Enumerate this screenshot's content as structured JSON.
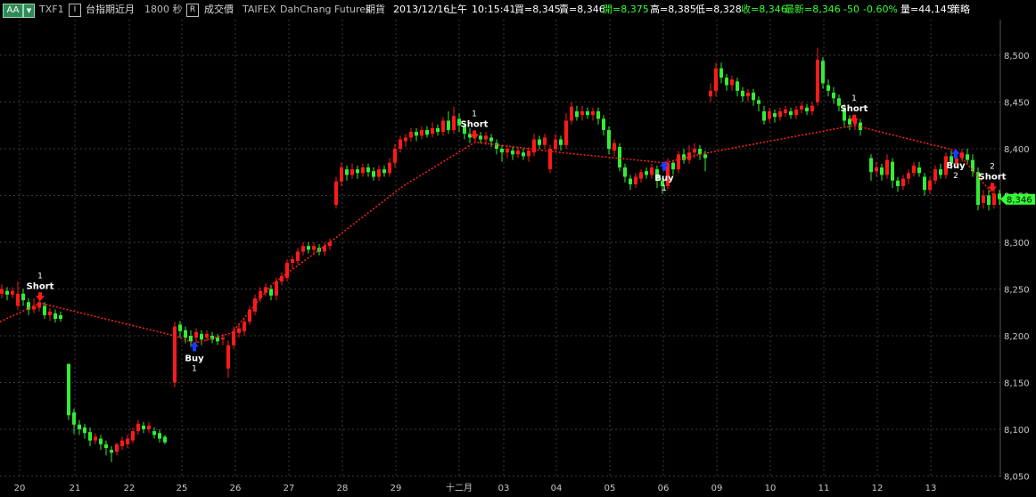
{
  "toolbar": {
    "aa_button": "AA",
    "symbol": "TXF1",
    "i_button": "I",
    "name": "台指期近月",
    "interval": "1800 秒",
    "r_button": "R",
    "price_type": "成交價",
    "exchange": "TAIFEX",
    "broker": "DahChang Futures",
    "category": "期貨",
    "date": "2013/12/16",
    "session": "上午",
    "time": "10:15:41",
    "bid": "買=8,345",
    "ask": "賣=8,346",
    "open": "開=8,375",
    "high": "高=8,385",
    "low": "低=8,328",
    "close": "收=8,346",
    "latest": "最新=8,346",
    "change": "-50",
    "change_pct": "-0.60%",
    "volume": "量=44,145",
    "strategy": "策略",
    "colors": {
      "green": "#33ff33",
      "white": "#ffffff"
    }
  },
  "chart_data": {
    "type": "candlestick",
    "ylim": [
      8040,
      8520
    ],
    "y_ticks": [
      "8,500",
      "8,450",
      "8,400",
      "8,350",
      "8,300",
      "8,250",
      "8,200",
      "8,150",
      "8,100",
      "8,050"
    ],
    "x_ticks": [
      "20",
      "21",
      "22",
      "25",
      "26",
      "27",
      "28",
      "29",
      "十二月",
      "03",
      "04",
      "05",
      "06",
      "09",
      "10",
      "11",
      "12",
      "13"
    ],
    "last_price": "8,346",
    "colors": {
      "up": "#ff1a1a",
      "down": "#33ee33",
      "signal_line": "#ff2020",
      "buy": "#1a3cff",
      "short": "#ff1a1a",
      "grid": "#3a3a3a",
      "last_bg": "#33ff33"
    },
    "signal_path": [
      [
        0,
        8215
      ],
      [
        45,
        8235
      ],
      [
        196,
        8200
      ],
      [
        218,
        8192
      ],
      [
        260,
        8203
      ],
      [
        305,
        8255
      ],
      [
        370,
        8300
      ],
      [
        452,
        8360
      ],
      [
        533,
        8407
      ],
      [
        628,
        8396
      ],
      [
        745,
        8385
      ],
      [
        790,
        8395
      ],
      [
        958,
        8425
      ],
      [
        1072,
        8398
      ],
      [
        1115,
        8350
      ]
    ],
    "signals": [
      {
        "kind": "Short",
        "count": "1",
        "x": 45,
        "price": 8235
      },
      {
        "kind": "Buy",
        "count": "1",
        "x": 218,
        "price": 8192
      },
      {
        "kind": "Short",
        "count": "1",
        "x": 532,
        "price": 8408
      },
      {
        "kind": "Buy",
        "count": "1",
        "x": 745,
        "price": 8385
      },
      {
        "kind": "Short",
        "count": "1",
        "x": 958,
        "price": 8425
      },
      {
        "kind": "Buy",
        "count": "2",
        "x": 1072,
        "price": 8398
      },
      {
        "kind": "Short",
        "count": "2",
        "x": 1113,
        "price": 8352
      }
    ],
    "candles": [
      [
        2,
        8245,
        8250,
        8240,
        8255
      ],
      [
        8,
        8248,
        8244,
        8238,
        8252
      ],
      [
        14,
        8244,
        8248,
        8240,
        8252
      ],
      [
        20,
        8232,
        8245,
        8228,
        8258
      ],
      [
        26,
        8245,
        8238,
        8232,
        8250
      ],
      [
        32,
        8236,
        8228,
        8222,
        8240
      ],
      [
        38,
        8228,
        8232,
        8224,
        8240
      ],
      [
        44,
        8230,
        8236,
        8226,
        8240
      ],
      [
        50,
        8232,
        8222,
        8218,
        8236
      ],
      [
        56,
        8222,
        8226,
        8216,
        8230
      ],
      [
        62,
        8224,
        8218,
        8214,
        8228
      ],
      [
        68,
        8222,
        8218,
        8215,
        8226
      ],
      [
        77,
        8170,
        8115,
        8110,
        8170
      ],
      [
        83,
        8118,
        8105,
        8095,
        8122
      ],
      [
        89,
        8105,
        8100,
        8094,
        8110
      ],
      [
        95,
        8102,
        8096,
        8090,
        8106
      ],
      [
        101,
        8097,
        8088,
        8082,
        8102
      ],
      [
        107,
        8088,
        8092,
        8084,
        8096
      ],
      [
        113,
        8090,
        8084,
        8078,
        8094
      ],
      [
        119,
        8084,
        8080,
        8072,
        8088
      ],
      [
        125,
        8078,
        8075,
        8065,
        8082
      ],
      [
        131,
        8076,
        8084,
        8072,
        8086
      ],
      [
        137,
        8082,
        8088,
        8078,
        8092
      ],
      [
        143,
        8084,
        8090,
        8080,
        8094
      ],
      [
        149,
        8088,
        8098,
        8085,
        8102
      ],
      [
        155,
        8098,
        8106,
        8094,
        8110
      ],
      [
        161,
        8104,
        8100,
        8096,
        8108
      ],
      [
        167,
        8100,
        8104,
        8096,
        8108
      ],
      [
        173,
        8098,
        8094,
        8090,
        8102
      ],
      [
        179,
        8096,
        8090,
        8086,
        8100
      ],
      [
        185,
        8092,
        8086,
        8084,
        8094
      ],
      [
        196,
        8150,
        8210,
        8145,
        8215
      ],
      [
        202,
        8212,
        8205,
        8198,
        8216
      ],
      [
        208,
        8206,
        8198,
        8192,
        8210
      ],
      [
        214,
        8200,
        8194,
        8188,
        8206
      ],
      [
        220,
        8198,
        8204,
        8192,
        8208
      ],
      [
        226,
        8202,
        8196,
        8190,
        8206
      ],
      [
        232,
        8198,
        8202,
        8194,
        8206
      ],
      [
        238,
        8200,
        8196,
        8192,
        8204
      ],
      [
        244,
        8198,
        8194,
        8190,
        8202
      ],
      [
        250,
        8196,
        8198,
        8190,
        8202
      ],
      [
        256,
        8165,
        8190,
        8155,
        8195
      ],
      [
        262,
        8190,
        8205,
        8186,
        8210
      ],
      [
        268,
        8203,
        8208,
        8198,
        8212
      ],
      [
        274,
        8205,
        8215,
        8200,
        8218
      ],
      [
        280,
        8215,
        8228,
        8212,
        8232
      ],
      [
        286,
        8226,
        8240,
        8222,
        8244
      ],
      [
        292,
        8240,
        8248,
        8236,
        8252
      ],
      [
        298,
        8246,
        8252,
        8242,
        8256
      ],
      [
        304,
        8250,
        8243,
        8238,
        8254
      ],
      [
        310,
        8243,
        8258,
        8238,
        8262
      ],
      [
        316,
        8258,
        8264,
        8254,
        8268
      ],
      [
        322,
        8262,
        8278,
        8258,
        8282
      ],
      [
        328,
        8278,
        8282,
        8272,
        8286
      ],
      [
        334,
        8280,
        8290,
        8276,
        8294
      ],
      [
        340,
        8290,
        8296,
        8286,
        8300
      ],
      [
        346,
        8296,
        8292,
        8288,
        8300
      ],
      [
        352,
        8292,
        8296,
        8288,
        8300
      ],
      [
        358,
        8294,
        8290,
        8286,
        8298
      ],
      [
        364,
        8290,
        8296,
        8286,
        8300
      ],
      [
        370,
        8296,
        8300,
        8292,
        8304
      ],
      [
        377,
        8340,
        8365,
        8336,
        8370
      ],
      [
        383,
        8365,
        8380,
        8360,
        8385
      ],
      [
        389,
        8378,
        8372,
        8366,
        8382
      ],
      [
        395,
        8372,
        8378,
        8368,
        8384
      ],
      [
        401,
        8378,
        8374,
        8368,
        8382
      ],
      [
        407,
        8374,
        8380,
        8370,
        8384
      ],
      [
        413,
        8380,
        8375,
        8370,
        8384
      ],
      [
        419,
        8376,
        8370,
        8366,
        8380
      ],
      [
        425,
        8370,
        8378,
        8366,
        8382
      ],
      [
        431,
        8378,
        8374,
        8370,
        8382
      ],
      [
        437,
        8374,
        8385,
        8370,
        8390
      ],
      [
        443,
        8385,
        8400,
        8380,
        8405
      ],
      [
        449,
        8400,
        8410,
        8396,
        8414
      ],
      [
        455,
        8408,
        8412,
        8402,
        8416
      ],
      [
        461,
        8412,
        8418,
        8408,
        8422
      ],
      [
        467,
        8418,
        8414,
        8408,
        8422
      ],
      [
        473,
        8414,
        8420,
        8410,
        8424
      ],
      [
        479,
        8420,
        8415,
        8412,
        8424
      ],
      [
        485,
        8416,
        8422,
        8412,
        8428
      ],
      [
        491,
        8422,
        8418,
        8414,
        8426
      ],
      [
        497,
        8418,
        8430,
        8414,
        8434
      ],
      [
        503,
        8430,
        8420,
        8416,
        8440
      ],
      [
        509,
        8420,
        8435,
        8416,
        8445
      ],
      [
        515,
        8432,
        8425,
        8418,
        8438
      ],
      [
        521,
        8424,
        8416,
        8410,
        8428
      ],
      [
        527,
        8416,
        8412,
        8406,
        8422
      ],
      [
        533,
        8412,
        8416,
        8406,
        8420
      ],
      [
        539,
        8414,
        8410,
        8406,
        8418
      ],
      [
        545,
        8410,
        8414,
        8404,
        8418
      ],
      [
        551,
        8412,
        8408,
        8402,
        8416
      ],
      [
        557,
        8406,
        8400,
        8394,
        8410
      ],
      [
        563,
        8400,
        8396,
        8386,
        8404
      ],
      [
        569,
        8396,
        8400,
        8390,
        8404
      ],
      [
        575,
        8398,
        8394,
        8388,
        8402
      ],
      [
        581,
        8394,
        8398,
        8390,
        8402
      ],
      [
        587,
        8396,
        8392,
        8388,
        8400
      ],
      [
        593,
        8392,
        8398,
        8386,
        8402
      ],
      [
        599,
        8396,
        8410,
        8392,
        8416
      ],
      [
        605,
        8410,
        8404,
        8400,
        8414
      ],
      [
        611,
        8404,
        8412,
        8400,
        8416
      ],
      [
        617,
        8378,
        8400,
        8374,
        8404
      ],
      [
        623,
        8400,
        8410,
        8396,
        8416
      ],
      [
        629,
        8410,
        8404,
        8398,
        8414
      ],
      [
        635,
        8404,
        8430,
        8400,
        8438
      ],
      [
        641,
        8430,
        8445,
        8426,
        8450
      ],
      [
        647,
        8440,
        8434,
        8430,
        8446
      ],
      [
        653,
        8436,
        8440,
        8430,
        8446
      ],
      [
        659,
        8440,
        8436,
        8432,
        8444
      ],
      [
        665,
        8436,
        8440,
        8430,
        8444
      ],
      [
        671,
        8440,
        8432,
        8426,
        8444
      ],
      [
        677,
        8432,
        8420,
        8414,
        8436
      ],
      [
        683,
        8420,
        8400,
        8394,
        8424
      ],
      [
        689,
        8398,
        8406,
        8392,
        8410
      ],
      [
        695,
        8402,
        8380,
        8376,
        8406
      ],
      [
        701,
        8380,
        8370,
        8364,
        8384
      ],
      [
        707,
        8368,
        8362,
        8356,
        8372
      ],
      [
        713,
        8362,
        8370,
        8358,
        8374
      ],
      [
        719,
        8368,
        8375,
        8364,
        8378
      ],
      [
        725,
        8376,
        8372,
        8368,
        8380
      ],
      [
        731,
        8372,
        8380,
        8368,
        8384
      ],
      [
        737,
        8378,
        8366,
        8358,
        8382
      ],
      [
        743,
        8366,
        8360,
        8352,
        8370
      ],
      [
        749,
        8360,
        8385,
        8356,
        8390
      ],
      [
        755,
        8385,
        8378,
        8372,
        8388
      ],
      [
        761,
        8378,
        8394,
        8374,
        8398
      ],
      [
        767,
        8394,
        8388,
        8384,
        8400
      ],
      [
        773,
        8388,
        8396,
        8384,
        8404
      ],
      [
        779,
        8396,
        8400,
        8390,
        8406
      ],
      [
        785,
        8400,
        8394,
        8388,
        8404
      ],
      [
        791,
        8394,
        8390,
        8376,
        8398
      ],
      [
        797,
        8456,
        8462,
        8450,
        8470
      ],
      [
        803,
        8462,
        8486,
        8456,
        8492
      ],
      [
        809,
        8486,
        8476,
        8470,
        8492
      ],
      [
        815,
        8476,
        8468,
        8462,
        8480
      ],
      [
        821,
        8468,
        8474,
        8462,
        8478
      ],
      [
        827,
        8472,
        8462,
        8456,
        8476
      ],
      [
        833,
        8462,
        8456,
        8450,
        8466
      ],
      [
        839,
        8456,
        8460,
        8450,
        8464
      ],
      [
        845,
        8460,
        8452,
        8446,
        8464
      ],
      [
        851,
        8452,
        8448,
        8440,
        8456
      ],
      [
        857,
        8440,
        8430,
        8426,
        8446
      ],
      [
        863,
        8432,
        8440,
        8428,
        8444
      ],
      [
        869,
        8438,
        8434,
        8428,
        8442
      ],
      [
        875,
        8434,
        8440,
        8430,
        8444
      ],
      [
        881,
        8438,
        8442,
        8434,
        8446
      ],
      [
        887,
        8440,
        8436,
        8432,
        8444
      ],
      [
        893,
        8436,
        8442,
        8432,
        8446
      ],
      [
        899,
        8442,
        8446,
        8438,
        8450
      ],
      [
        905,
        8444,
        8440,
        8436,
        8448
      ],
      [
        911,
        8440,
        8446,
        8436,
        8450
      ],
      [
        917,
        8450,
        8495,
        8446,
        8508
      ],
      [
        923,
        8494,
        8470,
        8464,
        8498
      ],
      [
        929,
        8468,
        8462,
        8456,
        8474
      ],
      [
        935,
        8460,
        8454,
        8448,
        8466
      ],
      [
        941,
        8454,
        8446,
        8440,
        8458
      ],
      [
        947,
        8444,
        8430,
        8424,
        8448
      ],
      [
        953,
        8432,
        8426,
        8420,
        8436
      ],
      [
        959,
        8426,
        8432,
        8420,
        8436
      ],
      [
        965,
        8428,
        8420,
        8414,
        8432
      ],
      [
        977,
        8390,
        8375,
        8366,
        8394
      ],
      [
        983,
        8376,
        8380,
        8370,
        8386
      ],
      [
        989,
        8380,
        8372,
        8366,
        8384
      ],
      [
        995,
        8372,
        8388,
        8368,
        8394
      ],
      [
        1001,
        8386,
        8366,
        8358,
        8390
      ],
      [
        1007,
        8366,
        8360,
        8354,
        8370
      ],
      [
        1013,
        8360,
        8368,
        8356,
        8372
      ],
      [
        1019,
        8368,
        8374,
        8362,
        8378
      ],
      [
        1025,
        8374,
        8382,
        8370,
        8386
      ],
      [
        1031,
        8380,
        8374,
        8370,
        8386
      ],
      [
        1037,
        8370,
        8356,
        8350,
        8374
      ],
      [
        1043,
        8356,
        8366,
        8352,
        8370
      ],
      [
        1049,
        8366,
        8378,
        8362,
        8382
      ],
      [
        1055,
        8378,
        8372,
        8368,
        8384
      ],
      [
        1061,
        8372,
        8392,
        8368,
        8396
      ],
      [
        1067,
        8392,
        8384,
        8378,
        8398
      ],
      [
        1073,
        8384,
        8390,
        8380,
        8396
      ],
      [
        1079,
        8390,
        8396,
        8386,
        8400
      ],
      [
        1085,
        8394,
        8388,
        8384,
        8400
      ],
      [
        1091,
        8388,
        8376,
        8370,
        8394
      ],
      [
        1097,
        8375,
        8340,
        8334,
        8380
      ],
      [
        1103,
        8342,
        8350,
        8336,
        8356
      ],
      [
        1109,
        8350,
        8340,
        8334,
        8356
      ],
      [
        1115,
        8340,
        8352,
        8336,
        8360
      ],
      [
        1121,
        8352,
        8346,
        8340,
        8356
      ]
    ]
  }
}
